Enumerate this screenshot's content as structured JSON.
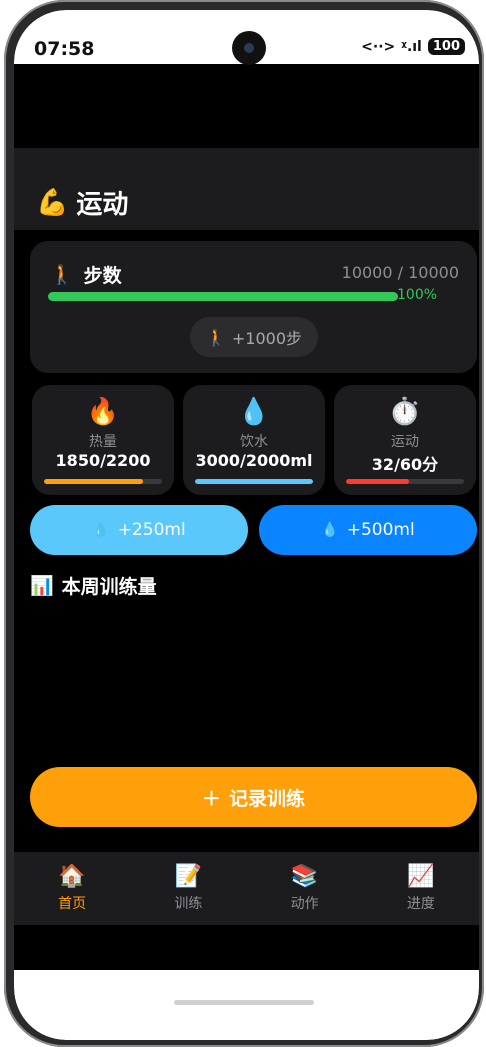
{
  "status": {
    "time": "07:58",
    "battery": "100"
  },
  "header": {
    "icon": "💪",
    "title": "运动"
  },
  "steps": {
    "icon": "🚶",
    "label": "步数",
    "value": "10000 / 10000",
    "percent_text": "100%",
    "progress": 1.0,
    "button_icon": "🚶",
    "button_label": "+1000步"
  },
  "stats": [
    {
      "icon": "🔥",
      "label": "热量",
      "value": "1850/2200",
      "fill": 0.84,
      "color": "#ff9f0a"
    },
    {
      "icon": "💧",
      "label": "饮水",
      "value": "3000/2000ml",
      "fill": 1.0,
      "color": "#5ac8fa"
    },
    {
      "icon": "⏱️",
      "label": "运动",
      "value": "32/60分",
      "fill": 0.53,
      "color": "#ff3b30"
    }
  ],
  "water": {
    "small_icon": "💧",
    "small_label": "+250ml",
    "large_icon": "💧",
    "large_label": "+500ml"
  },
  "week": {
    "icon": "📊",
    "title": "本周训练量"
  },
  "record": {
    "icon": "＋",
    "label": "记录训练"
  },
  "tabs": [
    {
      "icon": "🏠",
      "label": "首页"
    },
    {
      "icon": "📝",
      "label": "训练"
    },
    {
      "icon": "📚",
      "label": "动作"
    },
    {
      "icon": "📈",
      "label": "进度"
    }
  ]
}
